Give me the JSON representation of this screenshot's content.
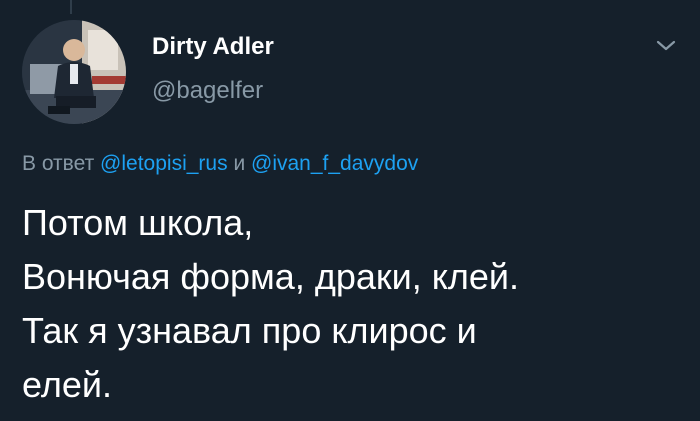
{
  "user": {
    "display_name": "Dirty Adler",
    "handle": "@bagelfer"
  },
  "icons": {
    "menu_caret": "chevron-down-icon"
  },
  "reply": {
    "prefix": "В ответ",
    "mention_1": "@letopisi_rus",
    "conjunction": "и",
    "mention_2": "@ivan_f_davydov"
  },
  "tweet": {
    "lines": [
      "Потом школа,",
      "Вонючая форма, драки, клей.",
      "Так я узнавал про клирос и",
      "елей."
    ]
  },
  "colors": {
    "background": "#15202b",
    "secondary_text": "#8899a6",
    "link": "#1da1f2",
    "primary_text": "#ffffff"
  }
}
